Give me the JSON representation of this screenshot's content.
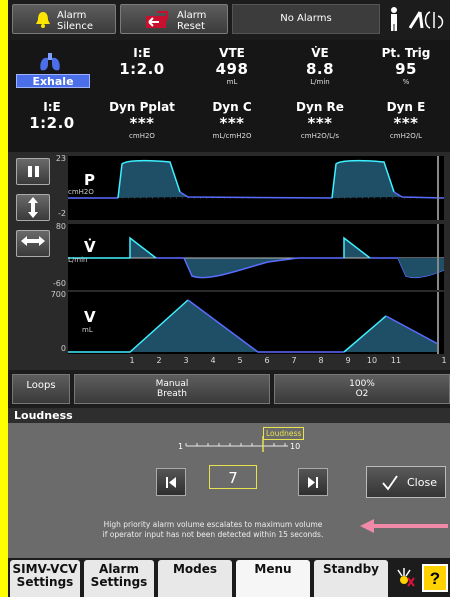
{
  "topbar": {
    "alarm_silence": "Alarm\nSilence",
    "alarm_silence_l1": "Alarm",
    "alarm_silence_l2": "Silence",
    "alarm_reset_l1": "Alarm",
    "alarm_reset_l2": "Reset",
    "status": "No Alarms"
  },
  "phase": "Exhale",
  "metrics_row1": [
    {
      "label": "I:E",
      "value": "1:2.0",
      "unit": ""
    },
    {
      "label": "VTE",
      "value": "498",
      "unit": "mL"
    },
    {
      "label": "V̇E",
      "value": "8.8",
      "unit": "L/min"
    },
    {
      "label": "Pt. Trig",
      "value": "95",
      "unit": "%"
    }
  ],
  "metrics_row2": [
    {
      "label": "I:E",
      "value": "1:2.0",
      "unit": ""
    },
    {
      "label": "Dyn Pplat",
      "value": "***",
      "unit": "cmH2O"
    },
    {
      "label": "Dyn C",
      "value": "***",
      "unit": "mL/cmH2O"
    },
    {
      "label": "Dyn Re",
      "value": "***",
      "unit": "cmH2O/L/s"
    },
    {
      "label": "Dyn E",
      "value": "***",
      "unit": "cmH2O/L"
    }
  ],
  "waveforms": {
    "pressure": {
      "label": "P",
      "unit": "cmH2O",
      "ymax": "23",
      "ymin": "-2"
    },
    "flow": {
      "label": "V̇",
      "unit": "L/min",
      "ymax": "80",
      "ymin": "-60"
    },
    "volume": {
      "label": "V",
      "unit": "mL",
      "ymax": "700",
      "ymin": "0"
    },
    "x_ticks": [
      "1",
      "2",
      "3",
      "4",
      "5",
      "6",
      "7",
      "8",
      "9",
      "10",
      "11",
      "1"
    ]
  },
  "buttons": {
    "loops": "Loops",
    "manual_breath_l1": "Manual",
    "manual_breath_l2": "Breath",
    "o2_l1": "100%",
    "o2_l2": "O2"
  },
  "loudness": {
    "title": "Loudness",
    "scale_min": "1",
    "scale_max": "10",
    "marker_label": "Loudness",
    "value": "7",
    "close": "Close",
    "note_l1": "High priority alarm volume escalates to maximum volume",
    "note_l2": "if operator input has not been detected within 15 seconds."
  },
  "tabs": [
    {
      "l1": "SIMV-VCV",
      "l2": "Settings"
    },
    {
      "l1": "Alarm",
      "l2": "Settings"
    },
    {
      "l1": "Modes",
      "l2": ""
    },
    {
      "l1": "Menu",
      "l2": ""
    },
    {
      "l1": "Standby",
      "l2": ""
    }
  ],
  "colors": {
    "frame": "#ffff00",
    "wave_fill": "#1e4f66",
    "wave_edge_cyan": "#3ff0ff",
    "wave_edge_blue": "#5a6cff",
    "exhale_badge": "#4a6fe8",
    "arrow": "#f08aa8",
    "help_button": "#ffd200"
  },
  "icons": [
    "bell-icon",
    "alarm-reset-icon",
    "person-icon",
    "lungs-icon",
    "pause-icon",
    "vertical-arrows-icon",
    "horizontal-arrows-icon",
    "prev-icon",
    "next-icon",
    "checkmark-icon",
    "help-icon"
  ]
}
